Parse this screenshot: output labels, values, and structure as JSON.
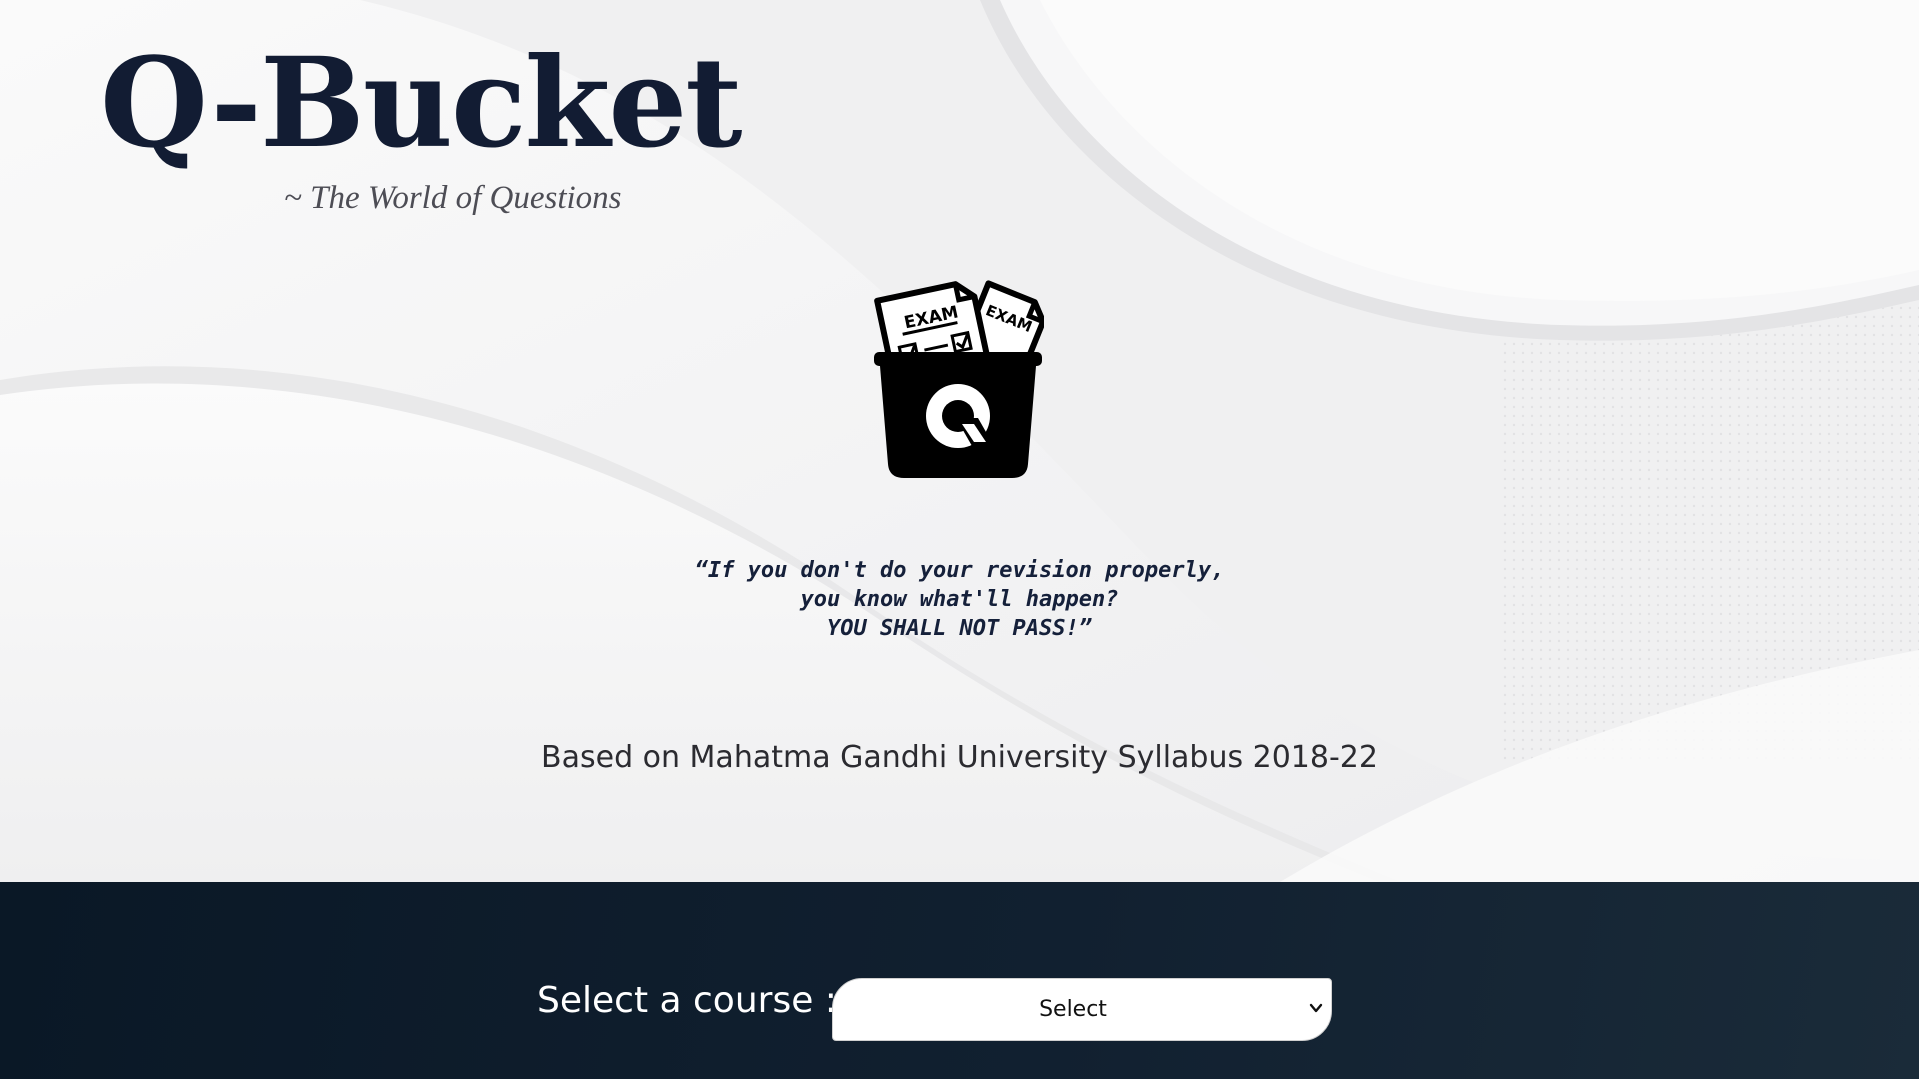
{
  "brand": {
    "title": "Q-Bucket",
    "tagline": "~ The World of Questions"
  },
  "logo": {
    "icon": "exam-bucket-icon",
    "paper_label_front": "EXAM",
    "paper_label_back": "EXAM",
    "bucket_letter": "Q"
  },
  "quote": {
    "line1": "“If you don't do your revision properly,",
    "line2": "you know what'll happen?",
    "line3": "YOU SHALL NOT PASS!”"
  },
  "syllabus_note": "Based on Mahatma Gandhi University Syllabus 2018-22",
  "course_picker": {
    "label": "Select a course :",
    "selected": "Select",
    "chevron_icon": "chevron-down-icon"
  },
  "colors": {
    "title": "#121c33",
    "footer_bg": "#0f1e2c",
    "hero_bg": "#f3f3f4"
  }
}
